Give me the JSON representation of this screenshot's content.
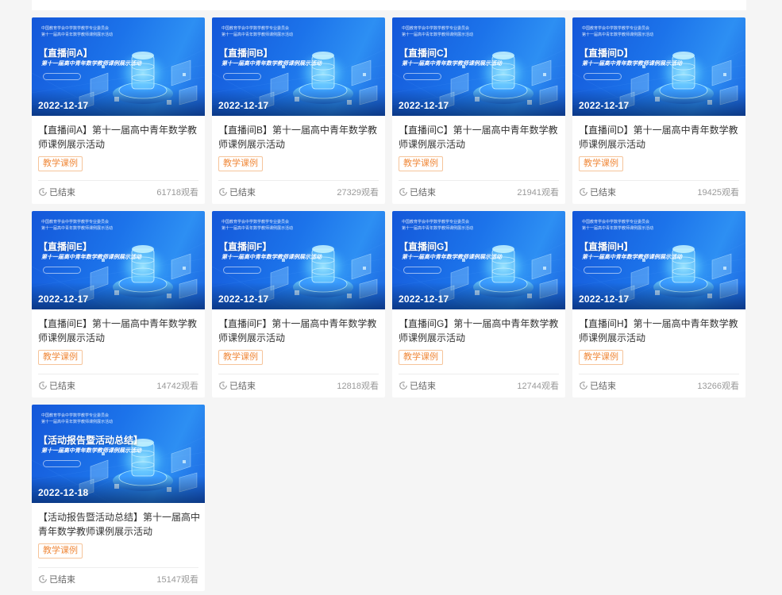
{
  "cards": [
    {
      "date": "2022-12-17",
      "banner": "【直播间A】",
      "title": "【直播间A】第十一届高中青年数学教师课例展示活动",
      "tag": "教学课例",
      "status": "已结束",
      "views": "61718观看"
    },
    {
      "date": "2022-12-17",
      "banner": "【直播间B】",
      "title": "【直播间B】第十一届高中青年数学教师课例展示活动",
      "tag": "教学课例",
      "status": "已结束",
      "views": "27329观看"
    },
    {
      "date": "2022-12-17",
      "banner": "【直播间C】",
      "title": "【直播间C】第十一届高中青年数学教师课例展示活动",
      "tag": "教学课例",
      "status": "已结束",
      "views": "21941观看"
    },
    {
      "date": "2022-12-17",
      "banner": "【直播间D】",
      "title": "【直播间D】第十一届高中青年数学教师课例展示活动",
      "tag": "教学课例",
      "status": "已结束",
      "views": "19425观看"
    },
    {
      "date": "2022-12-17",
      "banner": "【直播间E】",
      "title": "【直播间E】第十一届高中青年数学教师课例展示活动",
      "tag": "教学课例",
      "status": "已结束",
      "views": "14742观看"
    },
    {
      "date": "2022-12-17",
      "banner": "【直播间F】",
      "title": "【直播间F】第十一届高中青年数学教师课例展示活动",
      "tag": "教学课例",
      "status": "已结束",
      "views": "12818观看"
    },
    {
      "date": "2022-12-17",
      "banner": "【直播间G】",
      "title": "【直播间G】第十一届高中青年数学教师课例展示活动",
      "tag": "教学课例",
      "status": "已结束",
      "views": "12744观看"
    },
    {
      "date": "2022-12-17",
      "banner": "【直播间H】",
      "title": "【直播间H】第十一届高中青年数学教师课例展示活动",
      "tag": "教学课例",
      "status": "已结束",
      "views": "13266观看"
    },
    {
      "date": "2022-12-18",
      "banner": "【活动报告暨活动总结】",
      "title": "【活动报告暨活动总结】第十一届高中青年数学教师课例展示活动",
      "tag": "教学课例",
      "status": "已结束",
      "views": "15147观看"
    }
  ],
  "cover_subtitle": "第十一届高中青年数学教师课例展示活动",
  "cover_org": "中国教育学会中学数学教学专业委员会",
  "colors": {
    "tag_text": "#f08a3c",
    "tag_border": "#f6c49a",
    "cover_blue": "#1c73ea"
  },
  "icons": {
    "status": "replay-clock-icon"
  }
}
